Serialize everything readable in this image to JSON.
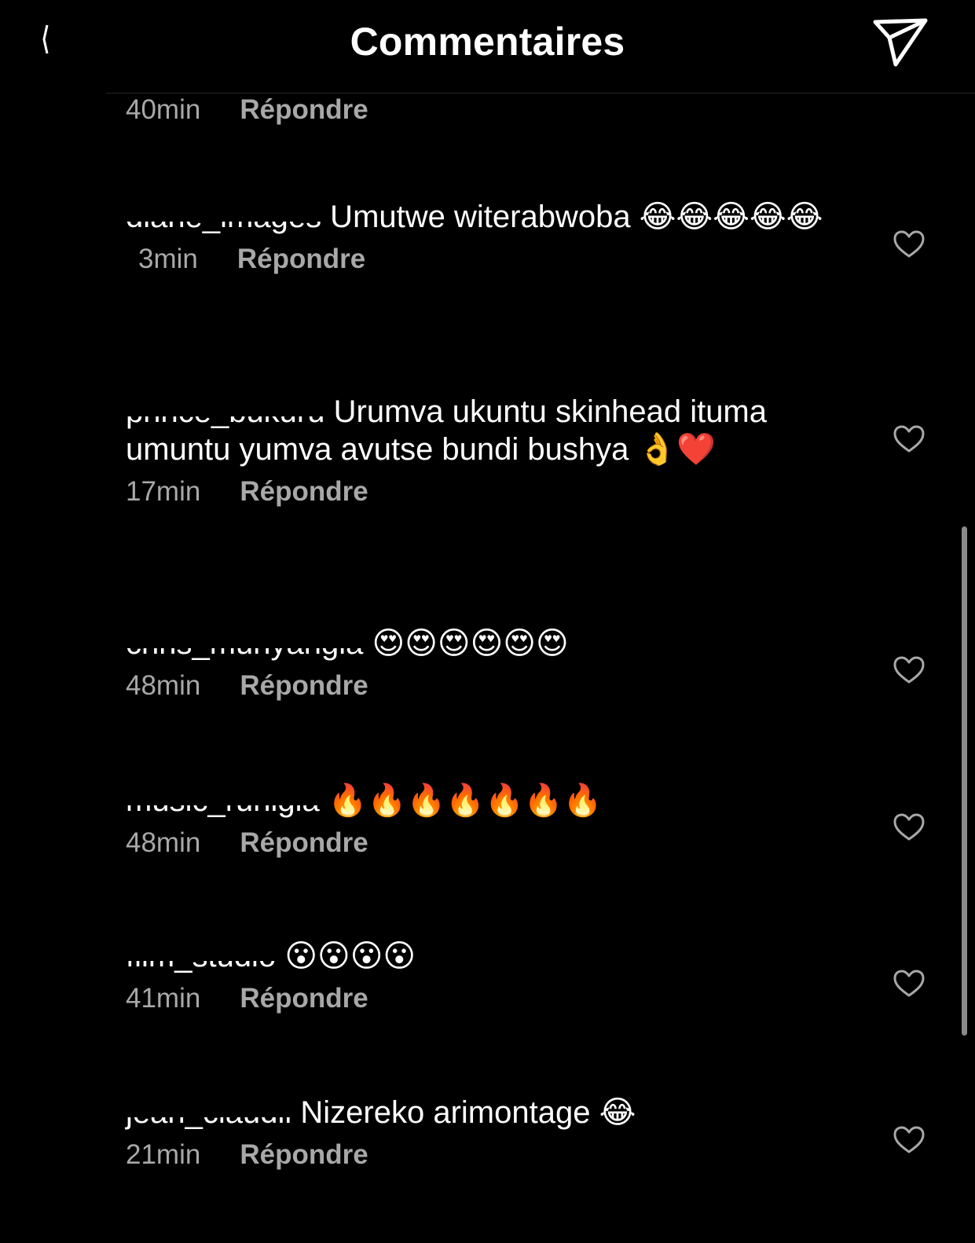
{
  "header": {
    "title": "Commentaires",
    "send_icon": "paper-plane-icon"
  },
  "top_meta": {
    "time": "40min",
    "reply": "Répondre"
  },
  "comments": [
    {
      "username": "diane_images",
      "text": " Umutwe witerabwoba 😂😂😂😂😂",
      "time": "3min",
      "reply": "Répondre"
    },
    {
      "username": "prince_bukuru",
      "text": " Urumva ukuntu skinhead ituma umuntu yumva avutse bundi bushya 👌❤️",
      "time": "17min",
      "reply": "Répondre"
    },
    {
      "username": "chris_munyangia",
      "text": " 😍😍😍😍😍😍",
      "time": "48min",
      "reply": "Répondre"
    },
    {
      "username": "music_ruhigia",
      "text": " 🔥🔥🔥🔥🔥🔥🔥",
      "time": "48min",
      "reply": "Répondre"
    },
    {
      "username": "film_studio",
      "text": " 😮😮😮😮",
      "time": "41min",
      "reply": "Répondre"
    },
    {
      "username": "jean_claudii",
      "text": " Nizereko arimontage 😂",
      "time": "21min",
      "reply": "Répondre"
    }
  ],
  "icons": {
    "like": "heart-outline-icon"
  },
  "colors": {
    "background": "#000000",
    "text": "#ffffff",
    "secondary": "#a8a8a8"
  }
}
